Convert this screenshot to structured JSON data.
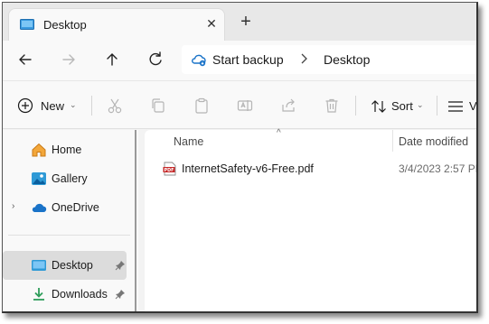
{
  "window": {
    "tab_title": "Desktop",
    "tab_icon": "desktop-folder-icon",
    "close_glyph": "✕",
    "new_tab_glyph": "+"
  },
  "address": {
    "segments": [
      "Start backup",
      "Desktop"
    ],
    "root_icon": "cloud-backup-icon"
  },
  "command_bar": {
    "new_label": "New",
    "sort_label": "Sort",
    "view_label": "V",
    "icons": [
      "cut-icon",
      "copy-icon",
      "paste-icon",
      "rename-icon",
      "share-icon",
      "delete-icon"
    ]
  },
  "sidebar": {
    "items": [
      {
        "label": "Home",
        "icon": "home-icon"
      },
      {
        "label": "Gallery",
        "icon": "gallery-icon"
      },
      {
        "label": "OneDrive",
        "icon": "cloud-icon",
        "expander": "›"
      },
      {
        "label": "Desktop",
        "icon": "desktop-folder-icon",
        "selected": true,
        "pinned": true
      },
      {
        "label": "Downloads",
        "icon": "download-icon",
        "pinned": true
      }
    ]
  },
  "file_list": {
    "columns": [
      "Name",
      "Date modified"
    ],
    "sort_indicator": "^",
    "rows": [
      {
        "name": "InternetSafety-v6-Free.pdf",
        "date": "3/4/2023 2:57 PM",
        "icon": "pdf-icon",
        "icon_label": "PDF"
      }
    ]
  },
  "colors": {
    "accent_blue": "#1a73c8",
    "pdf_red": "#c62828",
    "folder_teal": "#2f9ad6"
  }
}
